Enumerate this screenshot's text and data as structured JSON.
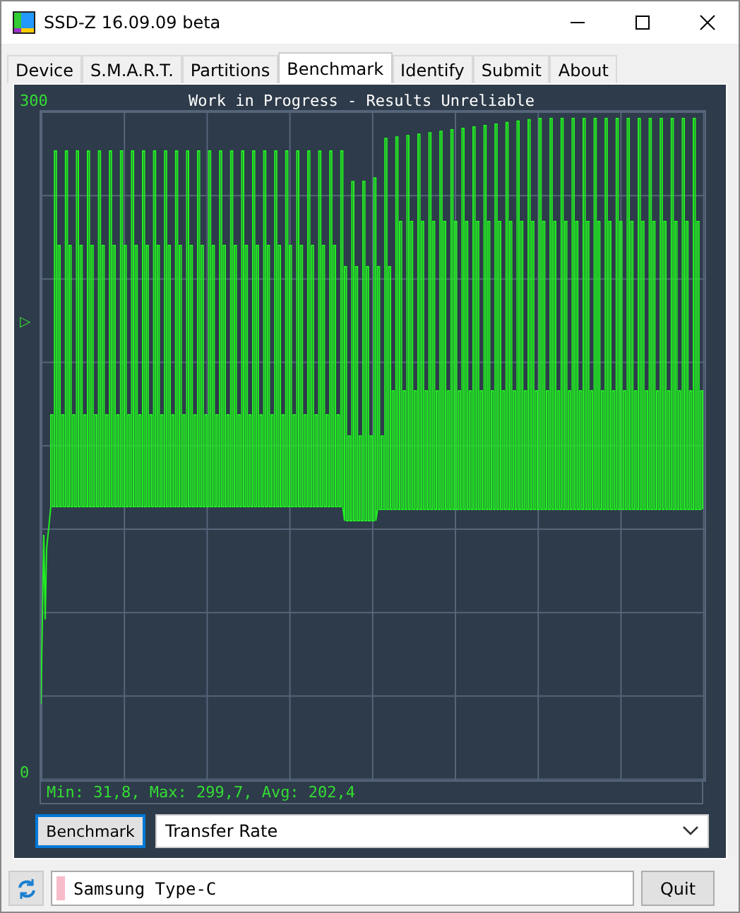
{
  "window": {
    "title": "SSD-Z 16.09.09 beta"
  },
  "tabs": [
    {
      "label": "Device",
      "selected": false
    },
    {
      "label": "S.M.A.R.T.",
      "selected": false
    },
    {
      "label": "Partitions",
      "selected": false
    },
    {
      "label": "Benchmark",
      "selected": true
    },
    {
      "label": "Identify",
      "selected": false
    },
    {
      "label": "Submit",
      "selected": false
    },
    {
      "label": "About",
      "selected": false
    }
  ],
  "graph": {
    "title": "Work in Progress - Results Unreliable",
    "y_max_label": "300",
    "y_min_label": "0",
    "marker": "▷",
    "stats": "Min: 31,8, Max: 299,7, Avg: 202,4"
  },
  "controls": {
    "button": "Benchmark",
    "mode": "Transfer Rate"
  },
  "status_bar": {
    "device": "Samsung Type-C",
    "quit": "Quit"
  }
}
